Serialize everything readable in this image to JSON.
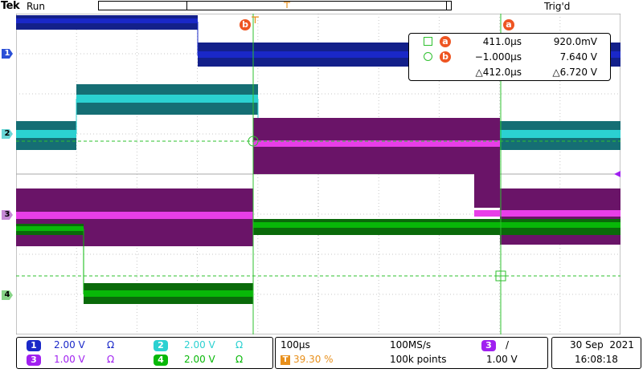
{
  "header": {
    "brand": "Tek",
    "status": "Run",
    "trigger_status": "Trig'd"
  },
  "colors": {
    "ch1": "#1a28c8",
    "ch2": "#2bd1d1",
    "ch3": "#a020f0",
    "ch4": "#08b808",
    "cursor": "#2ec02e",
    "accent": "#ee5522",
    "trigger": "#e8901c"
  },
  "channel_markers": [
    "1",
    "2",
    "3",
    "4"
  ],
  "cursor_labels": {
    "a": "a",
    "b": "b"
  },
  "readout": {
    "a_time": "411.0µs",
    "a_volt": "920.0mV",
    "b_time": "−1.000µs",
    "b_volt": "7.640 V",
    "delta_time": "△412.0µs",
    "delta_volt": "△6.720 V"
  },
  "channels_panel": {
    "ch1": {
      "num": "1",
      "scale": "2.00 V",
      "coupling": "Ω"
    },
    "ch2": {
      "num": "2",
      "scale": "2.00 V",
      "coupling": "Ω"
    },
    "ch3": {
      "num": "3",
      "scale": "1.00 V",
      "coupling": "Ω"
    },
    "ch4": {
      "num": "4",
      "scale": "2.00 V",
      "coupling": "Ω"
    }
  },
  "timebase": {
    "scale": "100µs",
    "position": "39.30 %",
    "sample_rate": "100MS/s",
    "record": "100k points"
  },
  "trigger": {
    "source": "3",
    "slope": "/",
    "level": "1.00 V"
  },
  "datetime": {
    "date": "30 Sep  2021",
    "time": "16:08:18"
  }
}
